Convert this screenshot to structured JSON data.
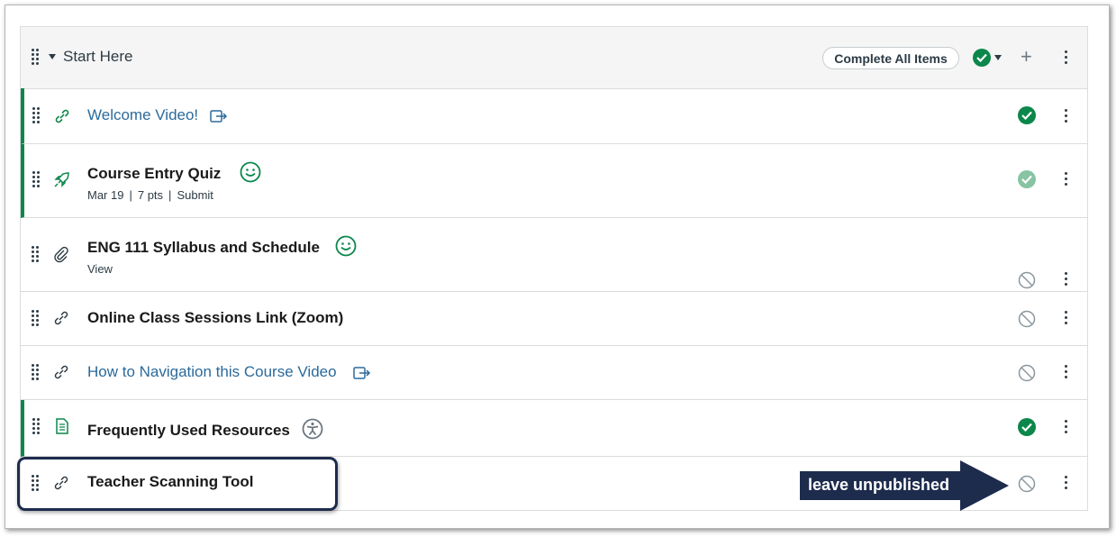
{
  "module": {
    "title": "Start Here",
    "complete_button_label": "Complete All Items",
    "add_label": "+"
  },
  "items": [
    {
      "title": "Welcome Video!",
      "type": "external-link",
      "status": "published"
    },
    {
      "title": "Course Entry Quiz",
      "type": "quiz",
      "status": "published",
      "meta": {
        "date": "Mar 19",
        "points": "7 pts",
        "action": "Submit"
      }
    },
    {
      "title": "ENG 111 Syllabus and Schedule",
      "type": "file",
      "status": "unpublished",
      "meta": {
        "action": "View"
      }
    },
    {
      "title": "Online Class Sessions Link (Zoom)",
      "type": "link",
      "status": "unpublished"
    },
    {
      "title": "How to Navigation this Course Video",
      "type": "external-link",
      "status": "unpublished"
    },
    {
      "title": "Frequently Used Resources",
      "type": "page",
      "status": "published"
    },
    {
      "title": "Teacher Scanning Tool",
      "type": "link",
      "status": "unpublished"
    }
  ],
  "annotation": {
    "text": "leave unpublished"
  },
  "colors": {
    "published": "#0b874b",
    "link": "#2b6a9b",
    "callout": "#1d2b4d"
  }
}
